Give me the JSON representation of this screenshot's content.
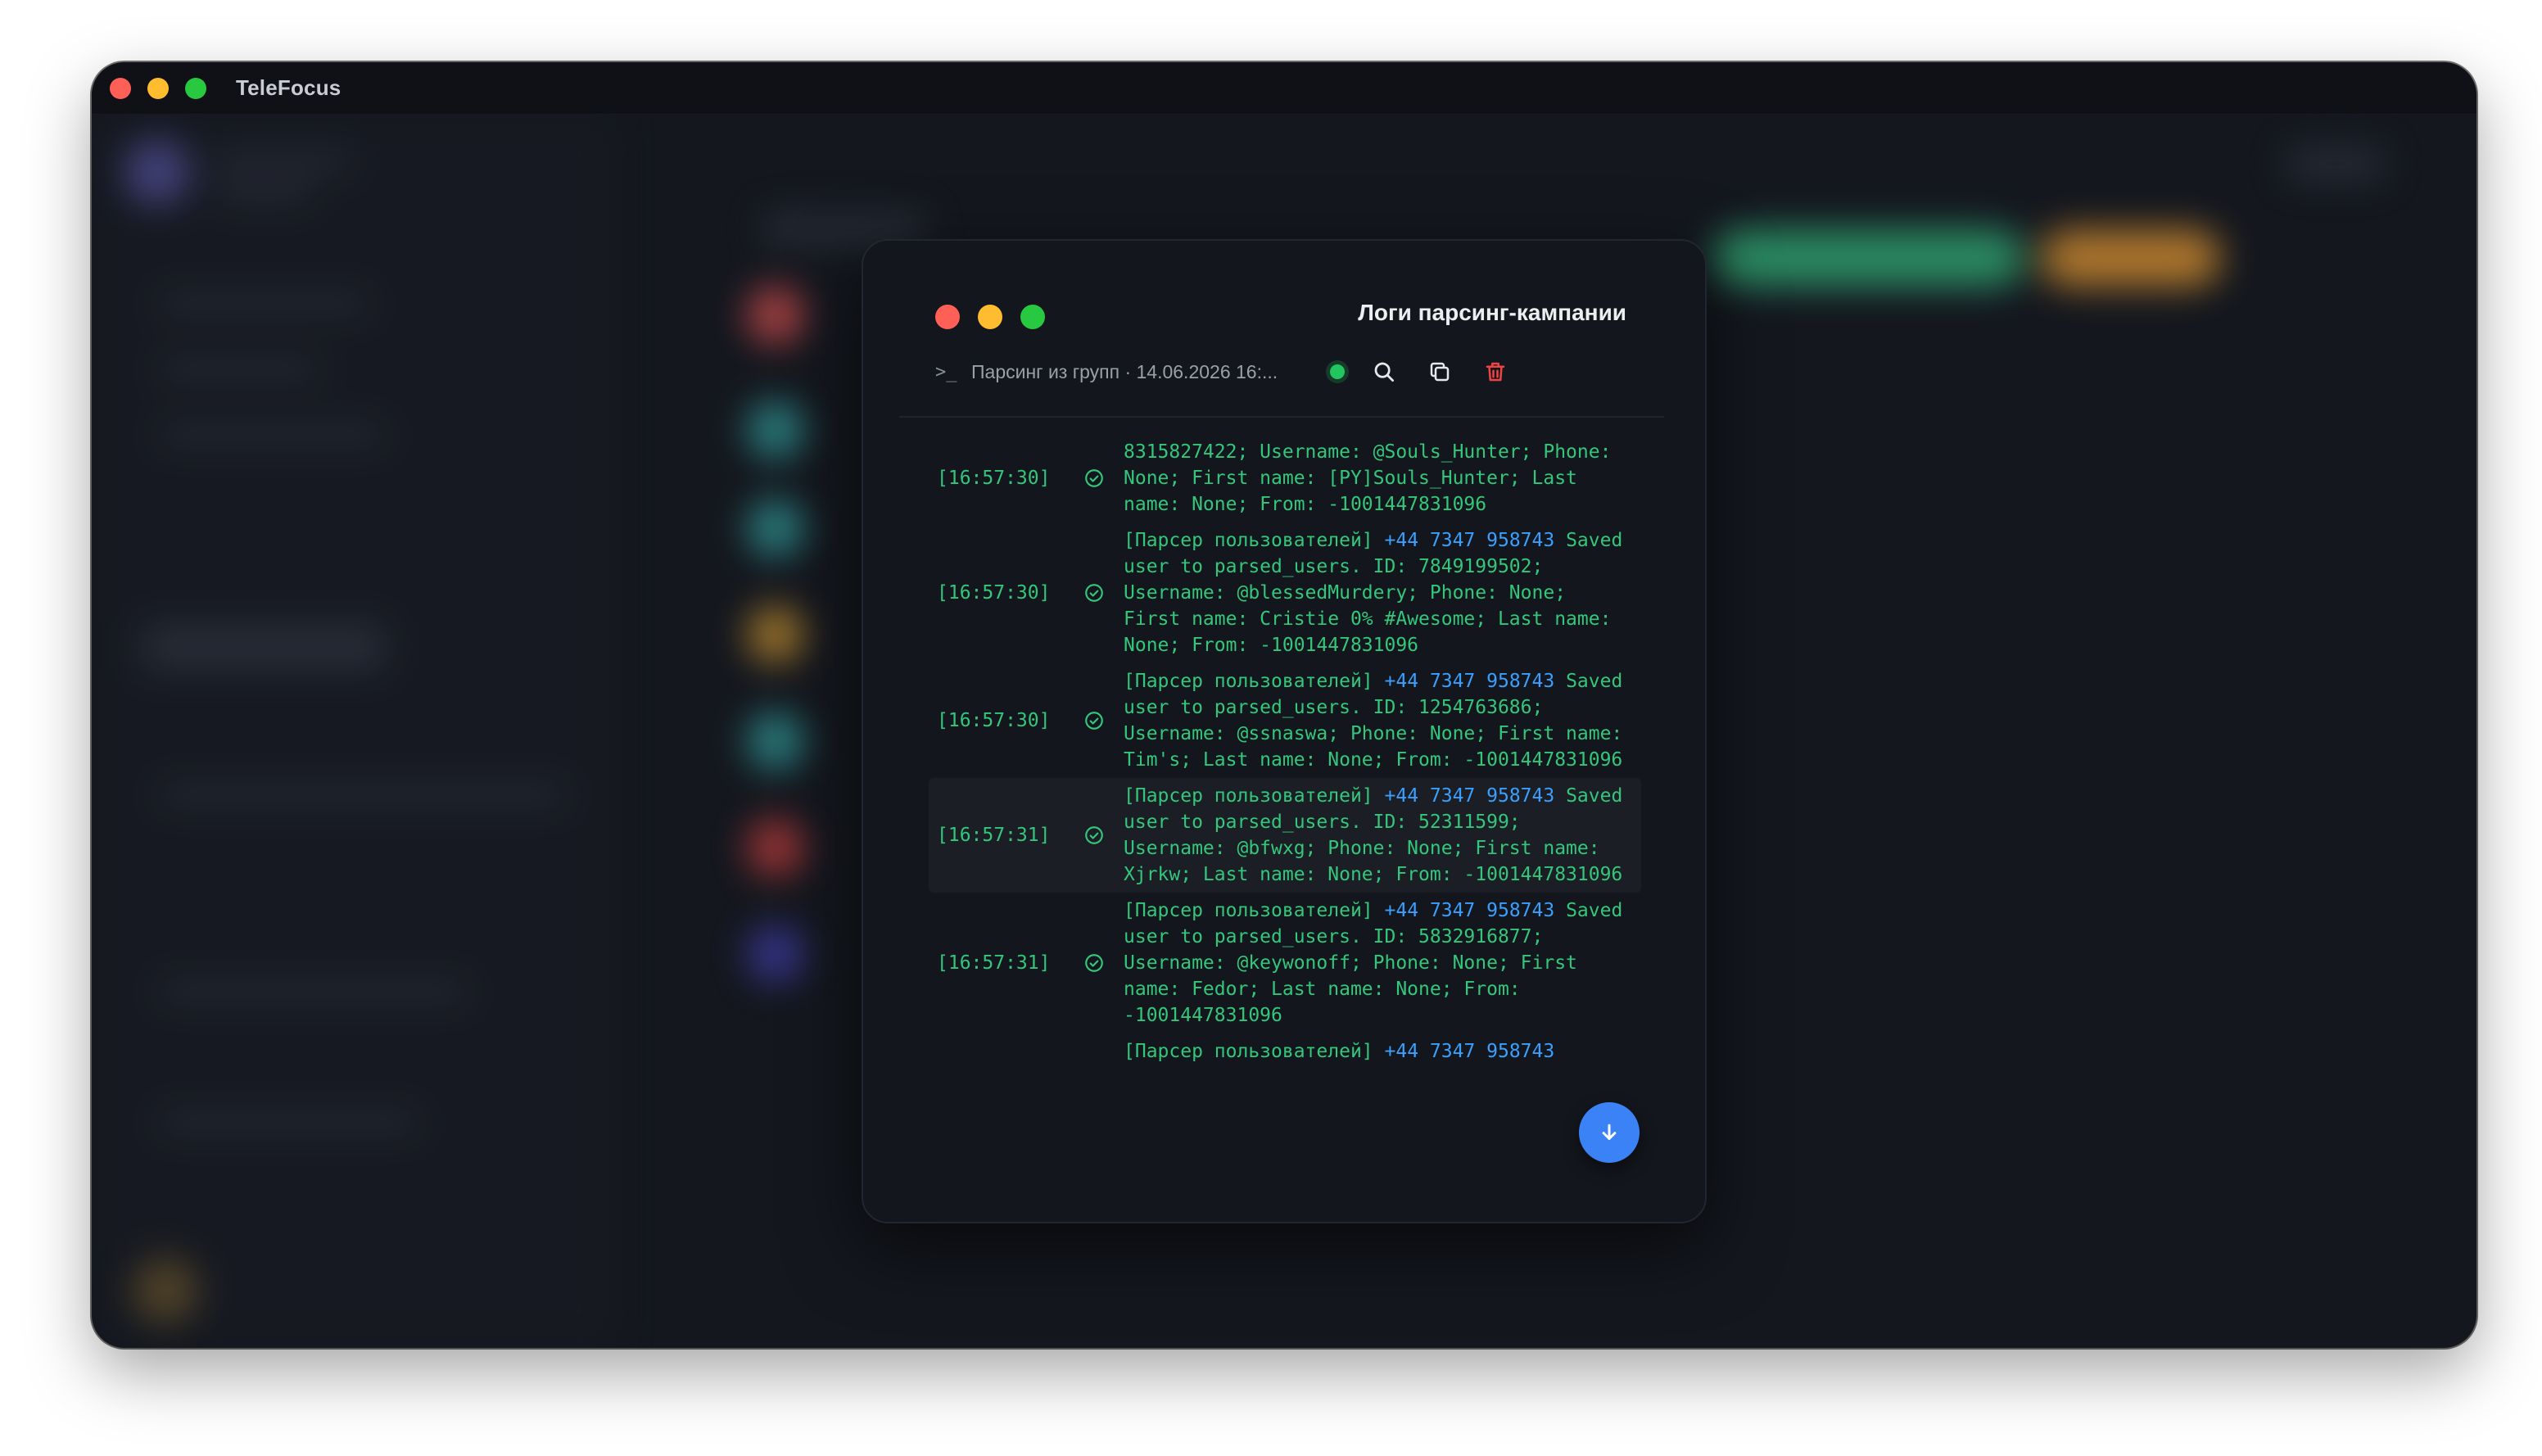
{
  "app": {
    "title": "TeleFocus"
  },
  "modal": {
    "title": "Логи парсинг-кампании",
    "session_label": "Парсинг из групп · 14.06.2026 16:...",
    "status": "running",
    "icons": [
      "terminal-icon",
      "search-icon",
      "copy-icon",
      "trash-icon",
      "arrow-down-icon"
    ]
  },
  "logs": [
    {
      "time": "[16:57:30]",
      "prefix": "",
      "phone": "",
      "message": "8315827422; Username: @Souls_Hunter; Phone: None; First name: [PY]Souls_Hunter; Last name: None; From: -1001447831096"
    },
    {
      "time": "[16:57:30]",
      "prefix": "[Парсер пользователей] ",
      "phone": "+44 7347 958743",
      "message": " Saved user to parsed_users. ID: 7849199502; Username: @blessedMurdery; Phone: None; First name: Cristie 0% #Awesome; Last name: None; From: -1001447831096"
    },
    {
      "time": "[16:57:30]",
      "prefix": "[Парсер пользователей] ",
      "phone": "+44 7347 958743",
      "message": " Saved user to parsed_users. ID: 1254763686; Username: @ssnaswa; Phone: None; First name: Tim's; Last name: None; From: -1001447831096"
    },
    {
      "time": "[16:57:31]",
      "prefix": "[Парсер пользователей] ",
      "phone": "+44 7347 958743",
      "message": " Saved user to parsed_users. ID: 52311599; Username: @bfwxg; Phone: None; First name: Xjrkw; Last name: None; From: -1001447831096"
    },
    {
      "time": "[16:57:31]",
      "prefix": "[Парсер пользователей] ",
      "phone": "+44 7347 958743",
      "message": " Saved user to parsed_users. ID: 5832916877; Username: @keywonoff; Phone: None; First name: Fedor; Last name: None; From: -1001447831096"
    },
    {
      "time": "",
      "prefix": "[Парсер пользователей] ",
      "phone": "+44 7347 958743",
      "message": ""
    }
  ]
}
